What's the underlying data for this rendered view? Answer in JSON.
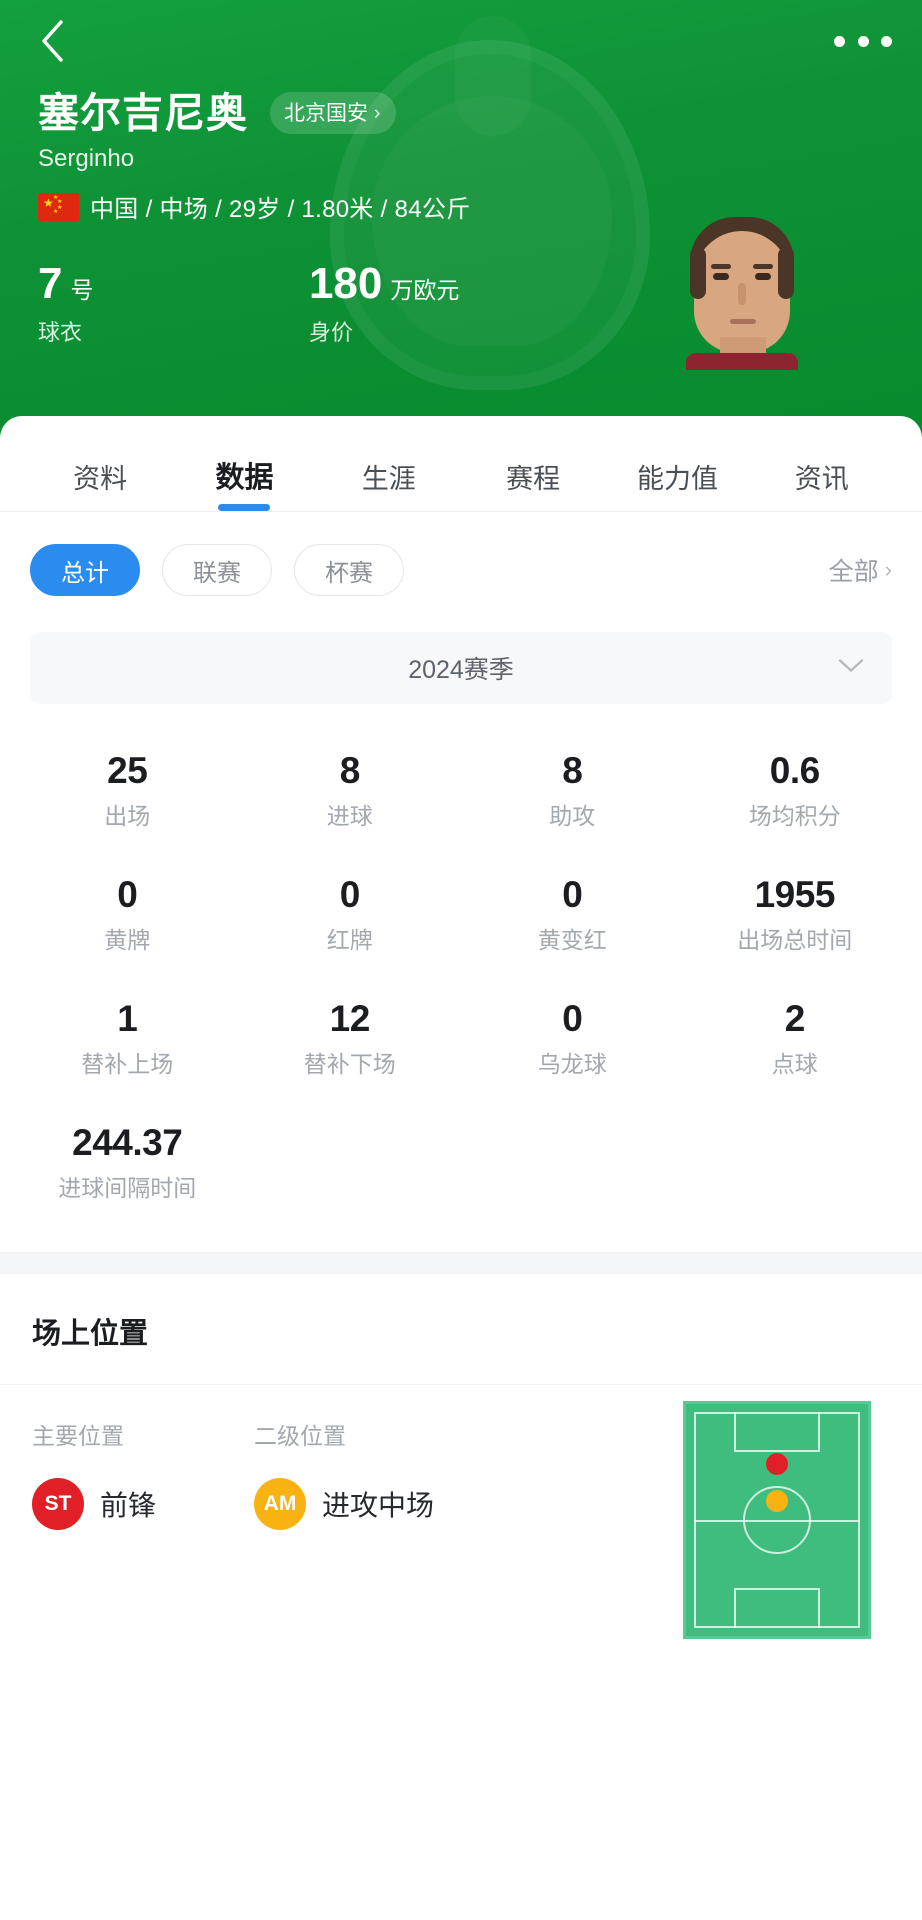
{
  "nav": {
    "back_icon": "chevron-left-icon",
    "more_icon": "more-options-icon"
  },
  "player": {
    "name_cn": "塞尔吉尼奥",
    "name_en": "Serginho",
    "team": "北京国安",
    "team_chevron": "›",
    "nationality": "中国",
    "meta_line": "中国 / 中场 / 29岁 / 1.80米 / 84公斤",
    "position_group": "中场",
    "age": "29岁",
    "height": "1.80米",
    "weight": "84公斤",
    "shirt": {
      "value": "7",
      "unit": "号",
      "label": "球衣"
    },
    "market_value": {
      "value": "180",
      "unit": "万欧元",
      "label": "身价"
    }
  },
  "tabs": [
    {
      "label": "资料",
      "active": false
    },
    {
      "label": "数据",
      "active": true
    },
    {
      "label": "生涯",
      "active": false
    },
    {
      "label": "赛程",
      "active": false
    },
    {
      "label": "能力值",
      "active": false
    },
    {
      "label": "资讯",
      "active": false
    }
  ],
  "filters": {
    "chips": [
      {
        "label": "总计",
        "active": true
      },
      {
        "label": "联赛",
        "active": false
      },
      {
        "label": "杯赛",
        "active": false
      }
    ],
    "all_label": "全部",
    "all_chevron": "›"
  },
  "season": {
    "label": "2024赛季",
    "chevron_icon": "chevron-down-icon"
  },
  "stats": [
    {
      "value": "25",
      "label": "出场"
    },
    {
      "value": "8",
      "label": "进球"
    },
    {
      "value": "8",
      "label": "助攻"
    },
    {
      "value": "0.6",
      "label": "场均积分"
    },
    {
      "value": "0",
      "label": "黄牌"
    },
    {
      "value": "0",
      "label": "红牌"
    },
    {
      "value": "0",
      "label": "黄变红"
    },
    {
      "value": "1955",
      "label": "出场总时间"
    },
    {
      "value": "1",
      "label": "替补上场"
    },
    {
      "value": "12",
      "label": "替补下场"
    },
    {
      "value": "0",
      "label": "乌龙球"
    },
    {
      "value": "2",
      "label": "点球"
    },
    {
      "value": "244.37",
      "label": "进球间隔时间"
    }
  ],
  "position_section": {
    "title": "场上位置",
    "primary": {
      "label": "主要位置",
      "badge": "ST",
      "badge_color": "#e01f26",
      "name": "前锋"
    },
    "secondary": {
      "label": "二级位置",
      "badge": "AM",
      "badge_color": "#f8b211",
      "name": "进攻中场"
    },
    "pitch": {
      "field_color": "#3fbd7f",
      "markers": [
        {
          "name": "ST",
          "color": "#e01f26",
          "x": 50,
          "y": 26
        },
        {
          "name": "AM",
          "color": "#f8b211",
          "x": 50,
          "y": 42
        }
      ]
    }
  },
  "colors": {
    "header_green": "#0f9236",
    "accent_blue": "#2b8cf0",
    "text_dark": "#1b1d20",
    "text_muted": "#a3a8af"
  }
}
